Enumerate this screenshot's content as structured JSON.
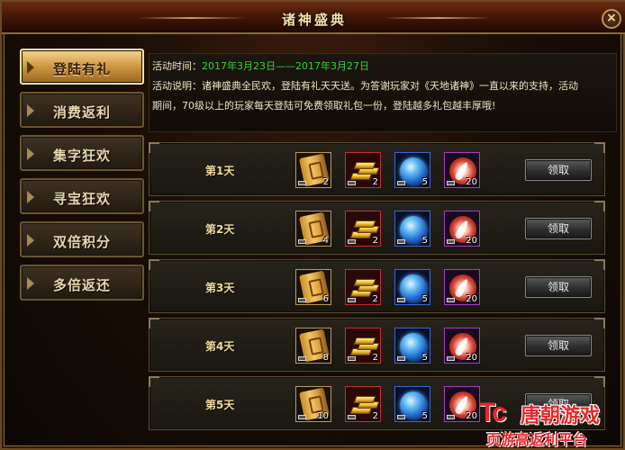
{
  "window": {
    "title": "诸神盛典",
    "close_label": "×"
  },
  "sidebar": {
    "items": [
      {
        "label": "登陆有礼",
        "active": true
      },
      {
        "label": "消费返利",
        "active": false
      },
      {
        "label": "集字狂欢",
        "active": false
      },
      {
        "label": "寻宝狂欢",
        "active": false
      },
      {
        "label": "双倍积分",
        "active": false
      },
      {
        "label": "多倍返还",
        "active": false
      }
    ]
  },
  "info": {
    "time_label": "活动时间：",
    "time_value": "2017年3月23日——2017年3月27日",
    "desc_line1": "活动说明：诸神盛典全民欢，登陆有礼天天送。为答谢玩家对《天地诸神》一直以来的支持，活动",
    "desc_line2": "期间，70级以上的玩家每天登陆可免费领取礼包一份，登陆越多礼包越丰厚哦!"
  },
  "rewards": {
    "claim_label": "领取",
    "rows": [
      {
        "day": "第1天",
        "items": [
          {
            "icon": "scroll-icon",
            "qty": "2"
          },
          {
            "icon": "gold-bars-icon",
            "qty": "2"
          },
          {
            "icon": "blue-orb-icon",
            "qty": "5"
          },
          {
            "icon": "feather-icon",
            "qty": "20"
          }
        ]
      },
      {
        "day": "第2天",
        "items": [
          {
            "icon": "scroll-icon",
            "qty": "4"
          },
          {
            "icon": "gold-bars-icon",
            "qty": "2"
          },
          {
            "icon": "blue-orb-icon",
            "qty": "5"
          },
          {
            "icon": "feather-icon",
            "qty": "20"
          }
        ]
      },
      {
        "day": "第3天",
        "items": [
          {
            "icon": "scroll-icon",
            "qty": "6"
          },
          {
            "icon": "gold-bars-icon",
            "qty": "2"
          },
          {
            "icon": "blue-orb-icon",
            "qty": "5"
          },
          {
            "icon": "feather-icon",
            "qty": "20"
          }
        ]
      },
      {
        "day": "第4天",
        "items": [
          {
            "icon": "scroll-icon",
            "qty": "8"
          },
          {
            "icon": "gold-bars-icon",
            "qty": "2"
          },
          {
            "icon": "blue-orb-icon",
            "qty": "5"
          },
          {
            "icon": "feather-icon",
            "qty": "20"
          }
        ]
      },
      {
        "day": "第5天",
        "items": [
          {
            "icon": "scroll-icon",
            "qty": "10"
          },
          {
            "icon": "gold-bars-icon",
            "qty": "2"
          },
          {
            "icon": "blue-orb-icon",
            "qty": "5"
          },
          {
            "icon": "feather-icon",
            "qty": "20"
          }
        ]
      }
    ]
  },
  "watermark": {
    "logo": "Tc",
    "name": "唐朝游戏",
    "tagline": "页游高返利平台"
  },
  "colors": {
    "date_green": "#33d533",
    "watermark_red": "#e8262a",
    "accent_gold": "#c8923c"
  }
}
